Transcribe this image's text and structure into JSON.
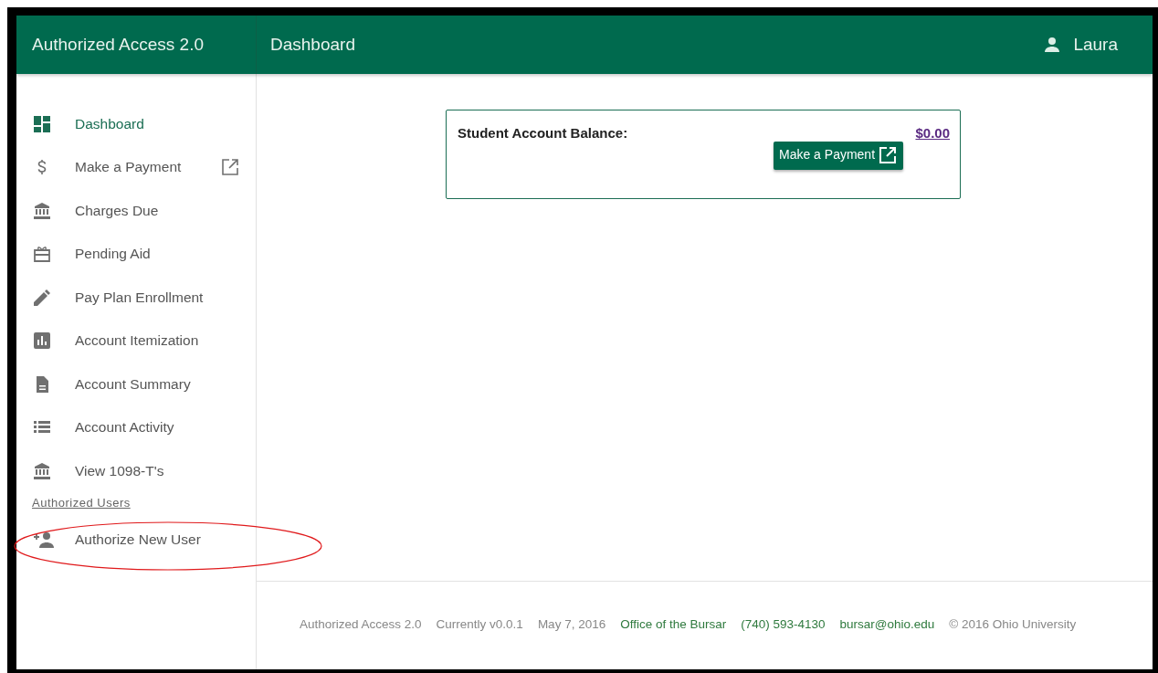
{
  "app": {
    "title": "Authorized Access 2.0"
  },
  "header": {
    "title": "Dashboard",
    "user": "Laura"
  },
  "sidebar": {
    "items": [
      {
        "label": "Dashboard",
        "selected": true,
        "external": false
      },
      {
        "label": "Make a Payment",
        "selected": false,
        "external": true
      },
      {
        "label": "Charges Due",
        "selected": false,
        "external": false
      },
      {
        "label": "Pending Aid",
        "selected": false,
        "external": false
      },
      {
        "label": "Pay Plan Enrollment",
        "selected": false,
        "external": false
      },
      {
        "label": "Account Itemization",
        "selected": false,
        "external": false
      },
      {
        "label": "Account Summary",
        "selected": false,
        "external": false
      },
      {
        "label": "Account Activity",
        "selected": false,
        "external": false
      },
      {
        "label": "View 1098-T's",
        "selected": false,
        "external": false
      }
    ],
    "section": "Authorized Users",
    "section_items": [
      {
        "label": "Authorize New User",
        "selected": false,
        "external": false
      }
    ]
  },
  "balance_card": {
    "label": "Student Account Balance:",
    "amount": "$0.00",
    "button": "Make a Payment"
  },
  "footer": [
    {
      "text": "Authorized Access 2.0",
      "kind": "text"
    },
    {
      "text": "Currently v0.0.1",
      "kind": "text"
    },
    {
      "text": "May 7, 2016",
      "kind": "text"
    },
    {
      "text": "Office of the Bursar",
      "kind": "link"
    },
    {
      "text": "(740) 593-4130",
      "kind": "link"
    },
    {
      "text": "bursar@ohio.edu",
      "kind": "link"
    },
    {
      "text": "© 2016 Ohio University",
      "kind": "text"
    }
  ]
}
